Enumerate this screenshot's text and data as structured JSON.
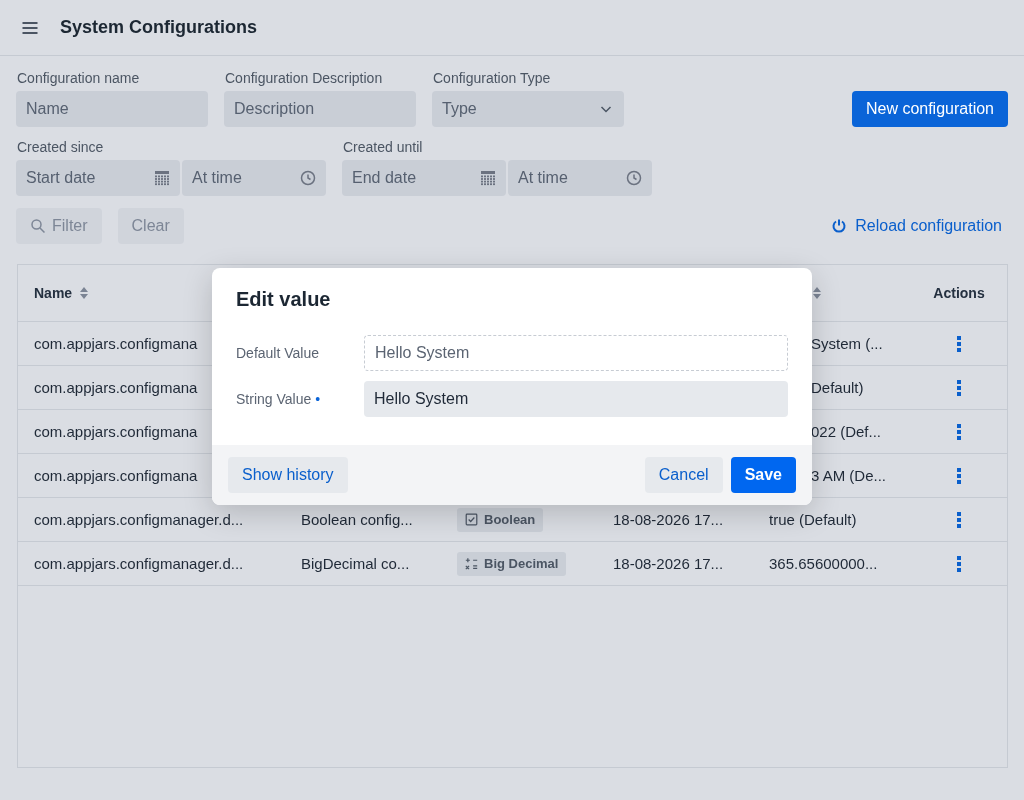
{
  "header": {
    "title": "System Configurations"
  },
  "filters": {
    "fields": [
      {
        "label": "Configuration name",
        "placeholder": "Name",
        "kind": "text"
      },
      {
        "label": "Configuration Description",
        "placeholder": "Description",
        "kind": "text"
      },
      {
        "label": "Configuration Type",
        "placeholder": "Type",
        "kind": "select"
      }
    ],
    "new_button": "New configuration",
    "ranges": [
      {
        "label": "Created since",
        "date_placeholder": "Start date",
        "time_placeholder": "At time"
      },
      {
        "label": "Created until",
        "date_placeholder": "End date",
        "time_placeholder": "At time"
      }
    ],
    "filter_button": {
      "label": "Filter",
      "disabled": true
    },
    "clear_button": {
      "label": "Clear",
      "disabled": true
    },
    "reload_link": "Reload configuration"
  },
  "table": {
    "columns": [
      {
        "label": "Name",
        "sortable": true
      },
      {
        "label": "Actions",
        "sortable": false
      }
    ],
    "rows": [
      {
        "name": "com.appjars.configmana",
        "value": "System (...",
        "covered": true
      },
      {
        "name": "com.appjars.configmana",
        "value": "Default)",
        "covered": true
      },
      {
        "name": "com.appjars.configmana",
        "value": "022 (Def...",
        "covered": true
      },
      {
        "name": "com.appjars.configmana",
        "value": "3 AM (De...",
        "covered": true
      },
      {
        "name": "com.appjars.configmanager.d...",
        "description": "Boolean config...",
        "type": {
          "label": "Boolean",
          "kind": "boolean"
        },
        "created": "18-08-2026 17...",
        "value": "true (Default)",
        "covered": false
      },
      {
        "name": "com.appjars.configmanager.d...",
        "description": "BigDecimal co...",
        "type": {
          "label": "Big Decimal",
          "kind": "decimal"
        },
        "created": "18-08-2026 17...",
        "value": "365.65600000...",
        "covered": false
      }
    ]
  },
  "dialog": {
    "title": "Edit value",
    "fields": [
      {
        "label": "Default Value",
        "value": "Hello System",
        "readonly": true
      },
      {
        "label": "String Value",
        "required_mark": "•",
        "value": "Hello System",
        "readonly": false
      }
    ],
    "history_button": "Show history",
    "cancel_button": "Cancel",
    "save_button": "Save"
  }
}
